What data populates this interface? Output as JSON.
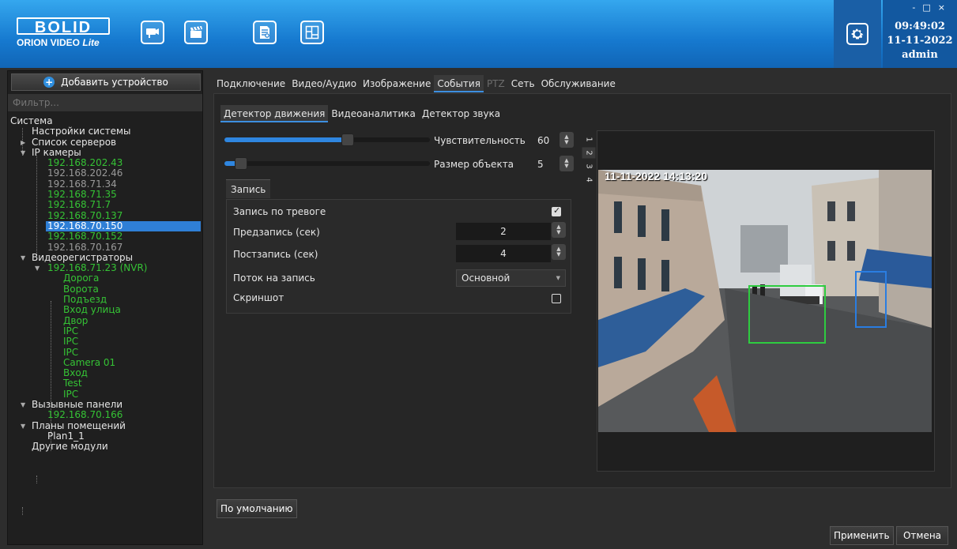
{
  "header": {
    "logo_brand": "BOLID",
    "logo_product": "ORION VIDEO",
    "logo_edition": "Lite",
    "toolbar_icons": [
      "camera-icon",
      "clapperboard-icon",
      "report-icon",
      "plan-icon"
    ],
    "settings_icon": "gear-icon",
    "window_controls": [
      "-",
      "□",
      "×"
    ],
    "time": "09:49:02",
    "date": "11-11-2022",
    "user": "admin",
    "colors": {
      "header_top": "#35a7ee",
      "header_bottom": "#1165b6",
      "status_panel": "#1258a0"
    }
  },
  "sidebar": {
    "add_device_label": "Добавить устройство",
    "filter_placeholder": "Фильтр...",
    "tree": {
      "root": "Система",
      "system_settings": "Настройки системы",
      "server_list": "Список серверов",
      "ip_cameras": "IP камеры",
      "ip_camera_items": [
        {
          "label": "192.168.202.43",
          "online": true
        },
        {
          "label": "192.168.202.46",
          "online": false
        },
        {
          "label": "192.168.71.34",
          "online": false
        },
        {
          "label": "192.168.71.35",
          "online": true
        },
        {
          "label": "192.168.71.7",
          "online": true
        },
        {
          "label": "192.168.70.137",
          "online": true
        },
        {
          "label": "192.168.70.150",
          "online": true,
          "selected": true
        },
        {
          "label": "192.168.70.152",
          "online": true
        },
        {
          "label": "192.168.70.167",
          "online": false
        }
      ],
      "recorders": "Видеорегистраторы",
      "nvr": "192.168.71.23 (NVR)",
      "nvr_channels": [
        "Дорога",
        "Ворота",
        "Подъезд",
        "Вход улица",
        "Двор",
        "IPC",
        "IPC",
        "IPC",
        "Camera 01",
        "Вход",
        "Test",
        "IPC"
      ],
      "call_panels": "Вызывные панели",
      "call_panel_items": [
        "192.168.70.166"
      ],
      "floor_plans": "Планы помещений",
      "floor_plan_items": [
        "Plan1_1"
      ],
      "other_modules": "Другие модули"
    }
  },
  "main": {
    "tabs": [
      {
        "label": "Подключение",
        "state": "normal"
      },
      {
        "label": "Видео/Аудио",
        "state": "normal"
      },
      {
        "label": "Изображение",
        "state": "normal"
      },
      {
        "label": "События",
        "state": "active"
      },
      {
        "label": "PTZ",
        "state": "disabled"
      },
      {
        "label": "Сеть",
        "state": "normal"
      },
      {
        "label": "Обслуживание",
        "state": "normal"
      }
    ],
    "subtabs": [
      {
        "label": "Детектор движения",
        "state": "active"
      },
      {
        "label": "Видеоаналитика",
        "state": "normal"
      },
      {
        "label": "Детектор звука",
        "state": "normal"
      }
    ],
    "sensitivity": {
      "label": "Чувствительность",
      "value": "60",
      "fraction": 0.6
    },
    "object_size": {
      "label": "Размер объекта",
      "value": "5",
      "fraction": 0.05
    },
    "recording": {
      "tab_label": "Запись",
      "alarm_record_label": "Запись по тревоге",
      "alarm_record_checked": true,
      "prerecord_label": "Предзапись (сек)",
      "prerecord_value": "2",
      "postrecord_label": "Постзапись (сек)",
      "postrecord_value": "4",
      "stream_label": "Поток на запись",
      "stream_value": "Основной",
      "screenshot_label": "Скриншот",
      "screenshot_checked": false
    },
    "zone_tabs": [
      "1",
      "2",
      "3",
      "4"
    ],
    "preview": {
      "timestamp": "11-11-2022 14:13:20",
      "zone_colors": [
        "#2ecc40",
        "#2a7de1"
      ]
    },
    "default_button": "По умолчанию",
    "apply_button": "Применить",
    "cancel_button": "Отмена"
  }
}
